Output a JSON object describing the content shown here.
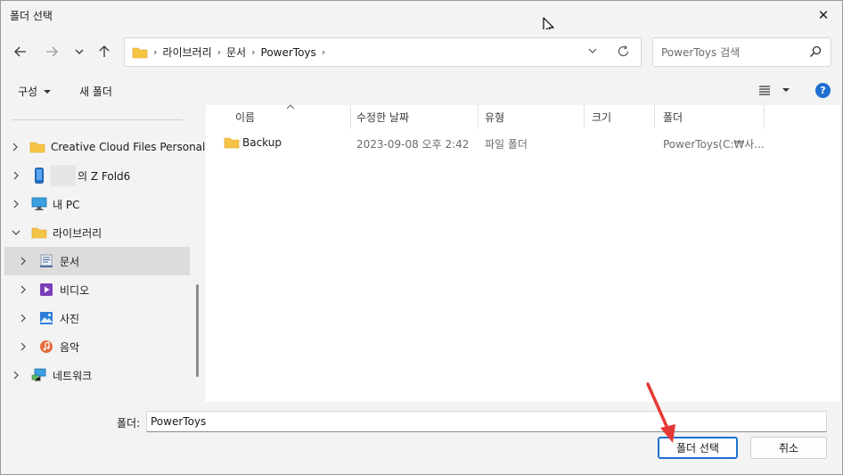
{
  "window": {
    "title": "폴더 선택",
    "close_glyph": "✕"
  },
  "nav": {
    "crumbs": [
      "라이브러리",
      "문서",
      "PowerToys"
    ],
    "sep": "›",
    "search_placeholder": "PowerToys 검색"
  },
  "commands": {
    "organize": "구성",
    "new_folder": "새 폴더",
    "help": "?"
  },
  "tree": {
    "items": [
      {
        "label": "Creative Cloud Files Personal",
        "icon": "folder-icon"
      },
      {
        "label": "의 Z Fold6",
        "icon": "phone-icon"
      },
      {
        "label": "내 PC",
        "icon": "monitor-icon"
      },
      {
        "label": "라이브러리",
        "icon": "folder-icon"
      },
      {
        "label": "문서",
        "icon": "document-icon"
      },
      {
        "label": "비디오",
        "icon": "video-icon"
      },
      {
        "label": "사진",
        "icon": "picture-icon"
      },
      {
        "label": "음악",
        "icon": "music-icon"
      },
      {
        "label": "네트워크",
        "icon": "network-icon"
      }
    ]
  },
  "columns": {
    "name": "이름",
    "modified": "수정한 날짜",
    "type": "유형",
    "size": "크기",
    "folder": "폴더"
  },
  "rows": [
    {
      "name": "Backup",
      "modified": "2023-09-08 오후 2:42",
      "type": "파일 폴더",
      "size": "",
      "folder": "PowerToys(C:₩사..."
    }
  ],
  "footer": {
    "folder_label": "폴더:",
    "folder_value": "PowerToys",
    "select_button": "폴더 선택",
    "cancel_button": "취소"
  },
  "colors": {
    "accent": "#1e6fd0",
    "folder": "#f6c445",
    "annotation": "#e53935"
  }
}
